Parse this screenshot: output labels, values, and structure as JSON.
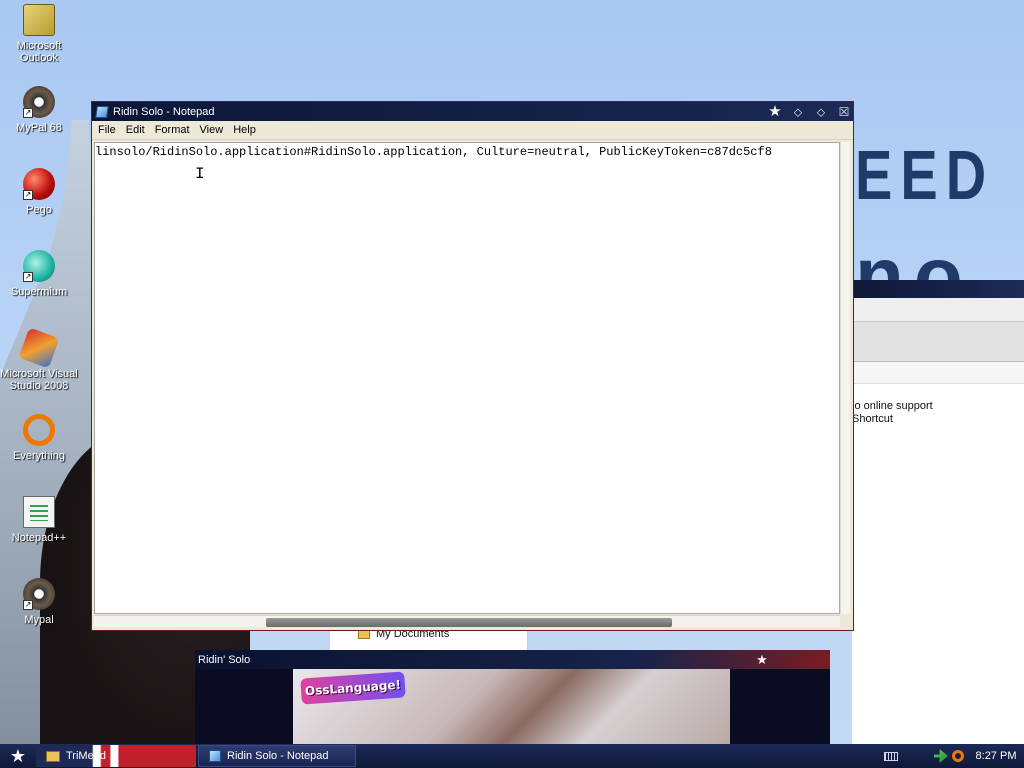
{
  "desktop": {
    "icons": [
      {
        "label": "Microsoft Outlook",
        "icon": "outlook-icon"
      },
      {
        "label": "MyPal 68",
        "icon": "mypal-icon"
      },
      {
        "label": "Pego",
        "icon": "pego-icon"
      },
      {
        "label": "Supermium",
        "icon": "supermium-icon"
      },
      {
        "label": "Microsoft Visual Studio 2008",
        "icon": "visual-studio-icon"
      },
      {
        "label": "Everything",
        "icon": "everything-icon"
      },
      {
        "label": "Notepad++",
        "icon": "notepadpp-icon"
      },
      {
        "label": "Mypal",
        "icon": "mypal-icon"
      }
    ],
    "wallpaper_text": [
      "EED",
      "no"
    ]
  },
  "notepad": {
    "title": "Ridin Solo - Notepad",
    "menu": [
      "File",
      "Edit",
      "Format",
      "View",
      "Help"
    ],
    "content": "linsolo/RidinSolo.application#RidinSolo.application, Culture=neutral, PublicKeyToken=c87dc5cf8",
    "controls": {
      "star": "★",
      "minimize": "⬦",
      "maximize": "⬦",
      "close": "☒"
    }
  },
  "background_explorer": {
    "rows": [
      "lo online support",
      "Shortcut"
    ],
    "nav_rows": [
      "My Documents"
    ]
  },
  "media_window": {
    "title": "Ridin' Solo",
    "badge_text": "OssLanguage!"
  },
  "taskbar": {
    "quick_launch_label": "TriMeed",
    "task_label": "Ridin Solo - Notepad",
    "clock": "8:27 PM"
  },
  "colors": {
    "titlebar": "#0b1636",
    "desktop": "#a9c8f2",
    "accent_red": "#c0202a"
  }
}
